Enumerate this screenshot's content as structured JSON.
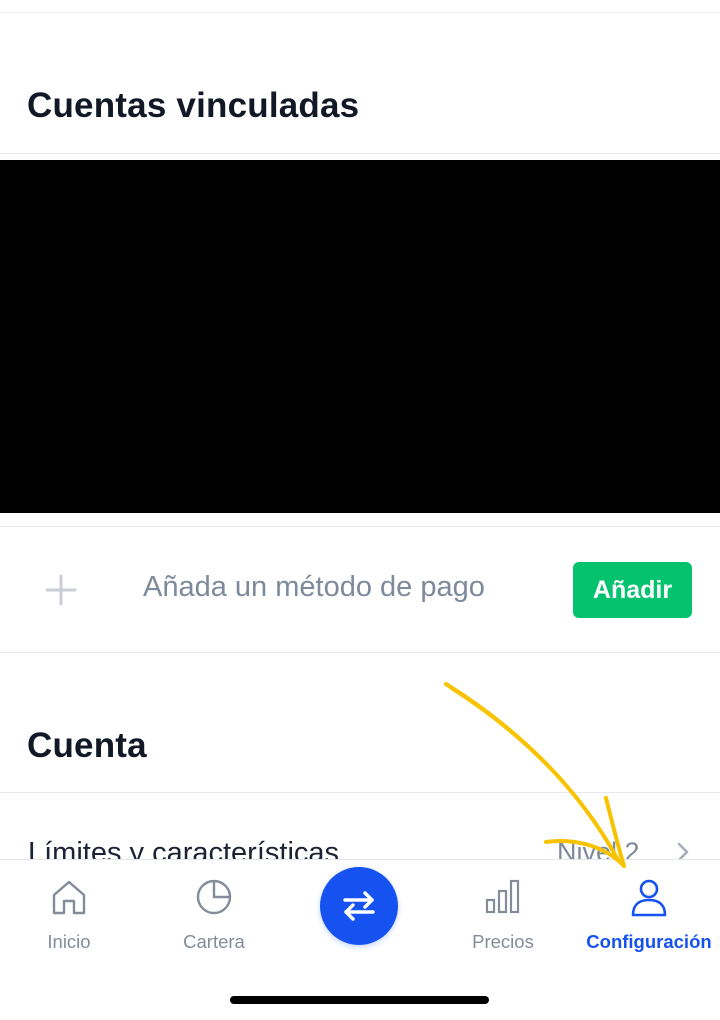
{
  "linked_accounts": {
    "title": "Cuentas vinculadas"
  },
  "payment": {
    "add_text": "Añada un método de pago",
    "add_button": "Añadir",
    "icon": "plus-icon"
  },
  "account": {
    "title": "Cuenta",
    "limits_label": "Límites y características",
    "limits_value": "Nivel 2"
  },
  "tabbar": {
    "tabs": [
      {
        "label": "Inicio",
        "icon": "home-icon",
        "active": false
      },
      {
        "label": "Cartera",
        "icon": "pie-chart-icon",
        "active": false
      },
      {
        "label": "Precios",
        "icon": "bar-chart-icon",
        "active": false
      },
      {
        "label": "Configuración",
        "icon": "user-icon",
        "active": true
      }
    ],
    "center_icon": "swap-arrows-icon"
  },
  "colors": {
    "accent_blue": "#1652f0",
    "add_green": "#05c26e",
    "annotation_yellow": "#f7c300",
    "muted_text": "#7d8a9c"
  }
}
